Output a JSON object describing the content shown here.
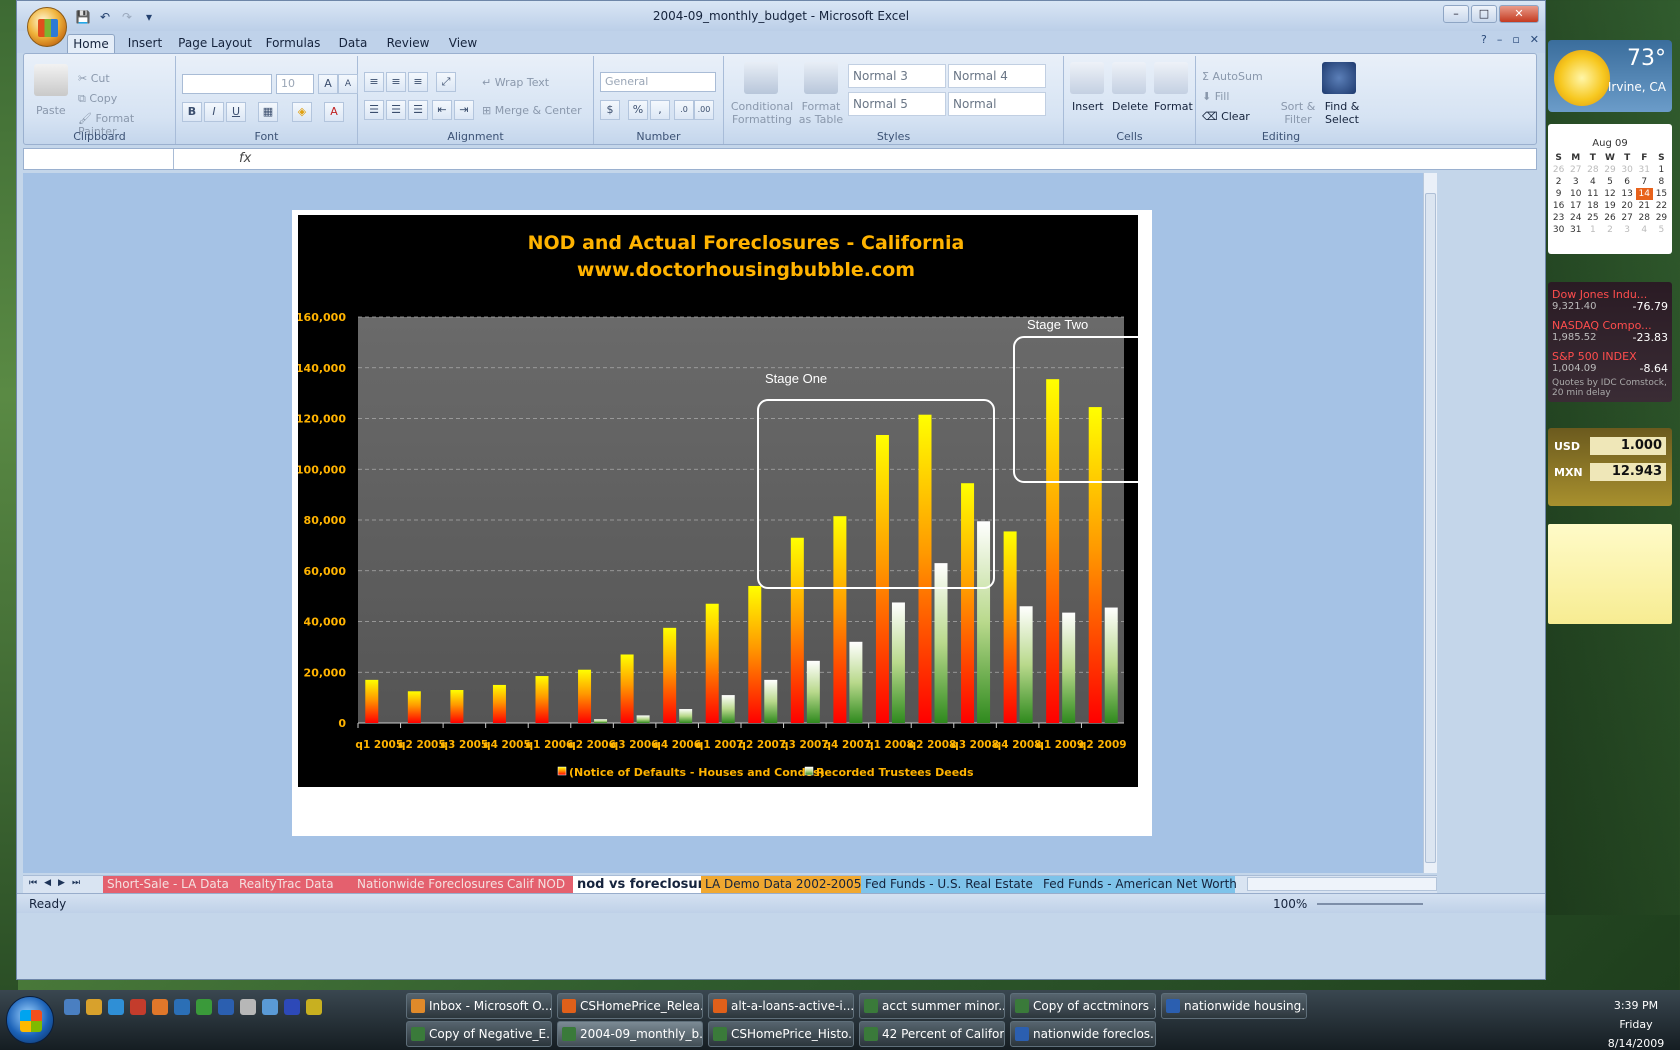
{
  "window": {
    "title": "2004-09_monthly_budget - Microsoft Excel"
  },
  "ribbon_tabs": [
    "Home",
    "Insert",
    "Page Layout",
    "Formulas",
    "Data",
    "Review",
    "View"
  ],
  "clipboard": {
    "paste": "Paste",
    "cut": "Cut",
    "copy": "Copy",
    "format_painter": "Format Painter",
    "label": "Clipboard"
  },
  "font": {
    "size": "10",
    "label": "Font"
  },
  "alignment": {
    "wrap": "Wrap Text",
    "merge": "Merge & Center",
    "label": "Alignment"
  },
  "number": {
    "format": "General",
    "label": "Number"
  },
  "styles": {
    "conditional": "Conditional Formatting",
    "format_table": "Format as Table",
    "cells": [
      "Normal 3",
      "Normal 4",
      "Normal 5",
      "Normal"
    ],
    "label": "Styles"
  },
  "cells": {
    "insert": "Insert",
    "delete": "Delete",
    "format": "Format",
    "label": "Cells"
  },
  "editing": {
    "autosum": "AutoSum",
    "fill": "Fill",
    "clear": "Clear",
    "sort": "Sort & Filter",
    "find": "Find & Select",
    "label": "Editing"
  },
  "formula_bar": {
    "fx": "fx"
  },
  "chart_data": {
    "type": "bar",
    "title": "NOD and Actual Foreclosures - California",
    "subtitle": "www.doctorhousingbubble.com",
    "categories": [
      "q1 2005",
      "q2 2005",
      "q3 2005",
      "q4 2005",
      "q1 2006",
      "q2 2006",
      "q3 2006",
      "q4 2006",
      "q1 2007",
      "q2 2007",
      "q3 2007",
      "q4 2007",
      "q1 2008",
      "q2 2008",
      "q3 2008",
      "q4 2008",
      "q1 2009",
      "q2 2009"
    ],
    "series": [
      {
        "name": "(Notice of Defaults - Houses and Condos)",
        "values": [
          17000,
          12500,
          13000,
          15000,
          18500,
          21000,
          27000,
          37500,
          47000,
          54000,
          73000,
          81500,
          113500,
          121500,
          94500,
          75500,
          135500,
          124500
        ],
        "color": "#ff6a00"
      },
      {
        "name": "Recorded Trustees Deeds",
        "values": [
          0,
          0,
          0,
          0,
          0,
          1500,
          3000,
          5500,
          11000,
          17000,
          24500,
          32000,
          47500,
          63000,
          79500,
          46000,
          43500,
          45500
        ],
        "color": "#8bc34a"
      }
    ],
    "ylim": [
      0,
      160000
    ],
    "yticks": [
      "0",
      "20,000",
      "40,000",
      "60,000",
      "80,000",
      "100,000",
      "120,000",
      "140,000",
      "160,000"
    ],
    "annotations": [
      "Stage One",
      "Stage Two"
    ],
    "legend_position": "bottom",
    "grid": true
  },
  "sheet_tabs": [
    {
      "label": "Short-Sale - LA Data",
      "color": "#e4606e"
    },
    {
      "label": "RealtyTrac Data",
      "color": "#e4606e"
    },
    {
      "label": "Nationwide Foreclosures",
      "color": "#e4606e"
    },
    {
      "label": "Calif NOD",
      "color": "#e4606e"
    },
    {
      "label": "nod vs foreclosure",
      "color": "#ffffff"
    },
    {
      "label": "LA Demo Data 2002-2005",
      "color": "#f0a830"
    },
    {
      "label": "Fed Funds - U.S. Real Estate",
      "color": "#7ec3ea"
    },
    {
      "label": "Fed Funds - American Net Worth",
      "color": "#7ec3ea"
    }
  ],
  "status": {
    "ready": "Ready",
    "zoom": "100%"
  },
  "gadgets": {
    "weather": {
      "temp": "73°",
      "city": "Irvine, CA"
    },
    "calendar": {
      "month": "Aug 09",
      "days": [
        "S",
        "M",
        "T",
        "W",
        "T",
        "F",
        "S"
      ],
      "rows": [
        [
          "26",
          "27",
          "28",
          "29",
          "30",
          "31",
          "1"
        ],
        [
          "2",
          "3",
          "4",
          "5",
          "6",
          "7",
          "8"
        ],
        [
          "9",
          "10",
          "11",
          "12",
          "13",
          "14",
          "15"
        ],
        [
          "16",
          "17",
          "18",
          "19",
          "20",
          "21",
          "22"
        ],
        [
          "23",
          "24",
          "25",
          "26",
          "27",
          "28",
          "29"
        ],
        [
          "30",
          "31",
          "1",
          "2",
          "3",
          "4",
          "5"
        ]
      ],
      "today": "14"
    },
    "stocks": [
      {
        "name": "Dow Jones Indu...",
        "value": "9,321.40",
        "change": "-76.79"
      },
      {
        "name": "NASDAQ Compo...",
        "value": "1,985.52",
        "change": "-23.83"
      },
      {
        "name": "S&P 500 INDEX",
        "value": "1,004.09",
        "change": "-8.64"
      }
    ],
    "stock_note": "Quotes by IDC Comstock, 20 min delay",
    "currency": [
      {
        "code": "USD",
        "value": "1.000"
      },
      {
        "code": "MXN",
        "value": "12.943"
      }
    ]
  },
  "taskbar": {
    "row1": [
      "Inbox - Microsoft O...",
      "CSHomePrice_Relea...",
      "alt-a-loans-active-i...",
      "acct summer minor...",
      "Copy of acctminors ...",
      "nationwide housing..."
    ],
    "row2": [
      "Copy of Negative_E...",
      "2004-09_monthly_b...",
      "CSHomePrice_Histo...",
      "42 Percent of Califor...",
      "nationwide foreclos..."
    ],
    "time": "3:39 PM",
    "day": "Friday",
    "date": "8/14/2009"
  }
}
